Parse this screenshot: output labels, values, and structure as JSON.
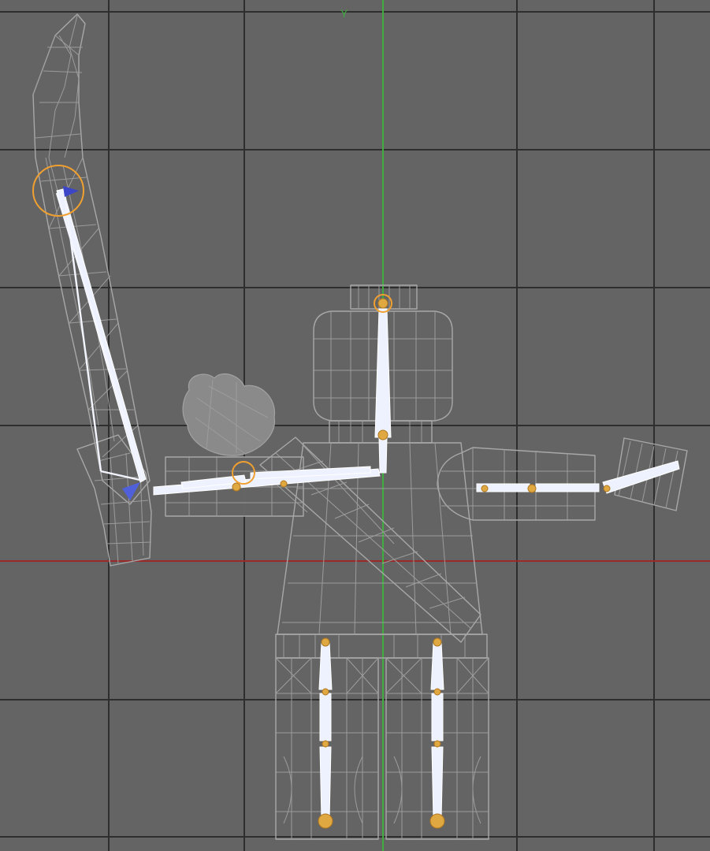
{
  "viewport": {
    "background": "#646464",
    "grid_color": "#2e2e2e",
    "x_axis_color": "#9a2a2a",
    "y_axis_color": "#3fae3f",
    "wire_color": "#a8a8a8",
    "bone_color": "#f4f6ff",
    "joint_color": "#e0a840",
    "selected_joint_color": "#f0a030",
    "y_axis_label": "Y",
    "object": "character-rig",
    "shading": "wireframe"
  }
}
